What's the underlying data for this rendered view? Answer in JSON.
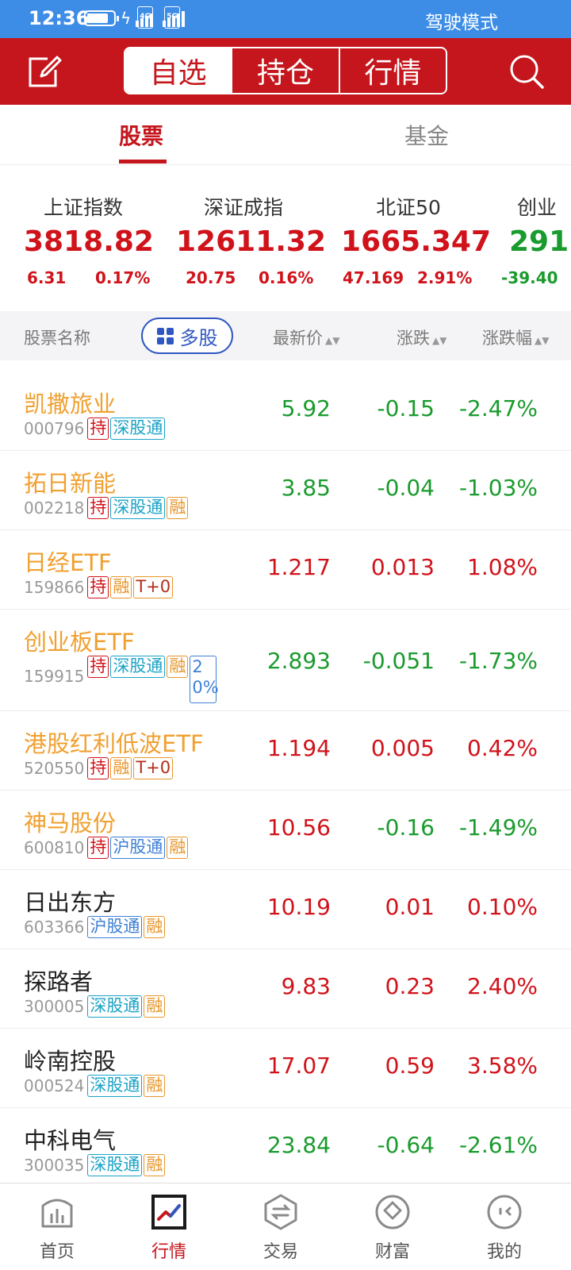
{
  "status_bar": {
    "time": "12:36",
    "net1": "4G",
    "net2": "5G",
    "driving_mode": "驾驶模式",
    "battery_percent": 80
  },
  "header": {
    "segments": [
      "自选",
      "持仓",
      "行情"
    ],
    "active_segment": "自选"
  },
  "sub_tabs": {
    "stocks": "股票",
    "funds": "基金"
  },
  "indices": [
    {
      "name": "上证指数",
      "value": "3818.82",
      "change": "6.31",
      "change_pct": "0.17%",
      "direction": "up"
    },
    {
      "name": "深证成指",
      "value": "12611.32",
      "change": "20.75",
      "change_pct": "0.16%",
      "direction": "up"
    },
    {
      "name": "北证50",
      "value": "1665.347",
      "change": "47.169",
      "change_pct": "2.91%",
      "direction": "up"
    },
    {
      "name": "创业",
      "value": "291",
      "change": "-39.40",
      "change_pct": "",
      "direction": "down"
    }
  ],
  "list_header": {
    "name_col": "股票名称",
    "multi_button": "多股",
    "price_col": "最新价",
    "change_col": "涨跌",
    "pct_col": "涨跌幅"
  },
  "stocks": [
    {
      "name": "凯撒旅业",
      "code": "000796",
      "tags": [
        "持",
        "深股通"
      ],
      "price": "5.92",
      "change": "-0.15",
      "pct": "-2.47%",
      "direction": "down",
      "held": true
    },
    {
      "name": "拓日新能",
      "code": "002218",
      "tags": [
        "持",
        "深股通",
        "融"
      ],
      "price": "3.85",
      "change": "-0.04",
      "pct": "-1.03%",
      "direction": "down",
      "held": true
    },
    {
      "name": "日经ETF",
      "code": "159866",
      "tags": [
        "持",
        "融",
        "T+0"
      ],
      "price": "1.217",
      "change": "0.013",
      "pct": "1.08%",
      "direction": "up",
      "held": true
    },
    {
      "name": "创业板ETF",
      "code": "159915",
      "tags": [
        "持",
        "深股通",
        "融",
        "20%"
      ],
      "price": "2.893",
      "change": "-0.051",
      "pct": "-1.73%",
      "direction": "down",
      "held": true
    },
    {
      "name": "港股红利低波ETF",
      "code": "520550",
      "tags": [
        "持",
        "融",
        "T+0"
      ],
      "price": "1.194",
      "change": "0.005",
      "pct": "0.42%",
      "direction": "up",
      "held": true
    },
    {
      "name": "神马股份",
      "code": "600810",
      "tags": [
        "持",
        "沪股通",
        "融"
      ],
      "price": "10.56",
      "change": "-0.16",
      "pct": "-1.49%",
      "direction": "down",
      "held": true
    },
    {
      "name": "日出东方",
      "code": "603366",
      "tags": [
        "沪股通",
        "融"
      ],
      "price": "10.19",
      "change": "0.01",
      "pct": "0.10%",
      "direction": "up",
      "held": false
    },
    {
      "name": "探路者",
      "code": "300005",
      "tags": [
        "深股通",
        "融"
      ],
      "price": "9.83",
      "change": "0.23",
      "pct": "2.40%",
      "direction": "up",
      "held": false
    },
    {
      "name": "岭南控股",
      "code": "000524",
      "tags": [
        "深股通",
        "融"
      ],
      "price": "17.07",
      "change": "0.59",
      "pct": "3.58%",
      "direction": "up",
      "held": false
    },
    {
      "name": "中科电气",
      "code": "300035",
      "tags": [
        "深股通",
        "融"
      ],
      "price": "23.84",
      "change": "-0.64",
      "pct": "-2.61%",
      "direction": "down",
      "held": false
    }
  ],
  "bottom_nav": [
    {
      "label": "首页",
      "icon": "home-chart-icon",
      "active": false
    },
    {
      "label": "行情",
      "icon": "market-trend-icon",
      "active": true
    },
    {
      "label": "交易",
      "icon": "trade-exchange-icon",
      "active": false
    },
    {
      "label": "财富",
      "icon": "wealth-diamond-icon",
      "active": false
    },
    {
      "label": "我的",
      "icon": "profile-face-icon",
      "active": false
    }
  ],
  "colors": {
    "brand_red": "#c4161c",
    "up": "#d0131b",
    "down": "#1a9b2e",
    "held_name": "#f0a030",
    "status_bar": "#3d8de6"
  }
}
